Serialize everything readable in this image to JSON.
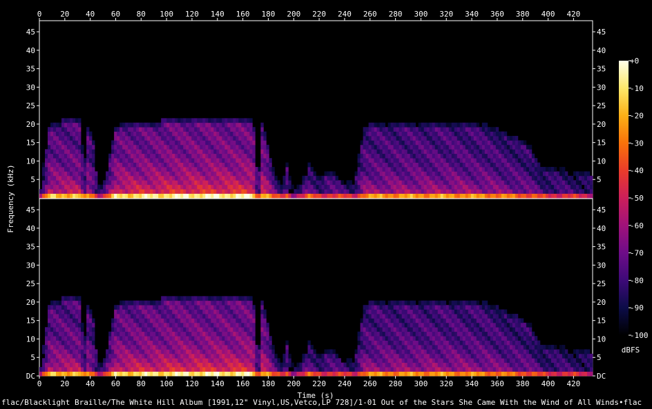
{
  "file_path": "flac/Blacklight Braille/The White Hill Album [1991,12\" Vinyl,US,Vetco,LP 728]/1-01 Out of the Stars She Came With the Wind of All Winds•flac",
  "chart_data": {
    "type": "heatmap",
    "xlabel": "Time (s)",
    "ylabel": "Frequency (kHz)",
    "xlim": [
      0,
      435
    ],
    "ylim": [
      0,
      48
    ],
    "x_ticks": [
      0,
      20,
      40,
      60,
      80,
      100,
      120,
      140,
      160,
      180,
      200,
      220,
      240,
      260,
      280,
      300,
      320,
      340,
      360,
      380,
      400,
      420
    ],
    "y_ticks_top": [
      "5",
      "10",
      "15",
      "20",
      "25",
      "30",
      "35",
      "40",
      "45"
    ],
    "y_ticks_bottom": [
      "DC",
      "5",
      "10",
      "15",
      "20",
      "25",
      "30",
      "35",
      "40",
      "45"
    ],
    "channels": 2,
    "colorbar": {
      "label": "dBFS",
      "range": [
        -100,
        0
      ],
      "ticks": [
        "+0",
        "-10",
        "-20",
        "-30",
        "-40",
        "-50",
        "-60",
        "-70",
        "-80",
        "-90",
        "-100"
      ],
      "colors": [
        "#000000",
        "#0c0c48",
        "#3d0a78",
        "#6e0c88",
        "#a0127a",
        "#cc1f5a",
        "#ea3c2a",
        "#f8720a",
        "#fcb016",
        "#fde86a",
        "#ffffe8"
      ]
    },
    "intensity_profile": {
      "time_s": [
        0,
        8,
        20,
        30,
        33,
        35,
        37,
        42,
        46,
        50,
        60,
        80,
        100,
        120,
        140,
        160,
        168,
        172,
        175,
        180,
        185,
        190,
        195,
        198,
        205,
        212,
        220,
        230,
        240,
        248,
        255,
        270,
        300,
        320,
        330,
        340,
        355,
        365,
        375,
        385,
        392,
        395,
        410,
        425,
        435
      ],
      "bandwidth_khz": [
        1,
        20,
        20.5,
        20.5,
        20.5,
        3,
        20,
        16,
        3,
        3,
        19,
        20,
        20.5,
        20.5,
        20.5,
        20.5,
        20.5,
        3,
        20,
        13,
        6,
        3,
        9,
        3,
        3,
        9,
        5,
        7,
        4,
        4,
        19,
        20,
        20,
        20,
        20,
        20,
        19,
        17,
        16,
        14,
        9,
        8,
        8,
        6,
        6
      ],
      "level": [
        0.05,
        0.55,
        0.55,
        0.55,
        0.55,
        0.15,
        0.55,
        0.4,
        0.2,
        0.2,
        0.6,
        0.62,
        0.64,
        0.66,
        0.66,
        0.66,
        0.66,
        0.2,
        0.62,
        0.5,
        0.3,
        0.2,
        0.35,
        0.1,
        0.2,
        0.35,
        0.25,
        0.3,
        0.25,
        0.2,
        0.45,
        0.46,
        0.47,
        0.47,
        0.47,
        0.45,
        0.44,
        0.4,
        0.38,
        0.35,
        0.3,
        0.25,
        0.25,
        0.22,
        0.2
      ]
    }
  }
}
